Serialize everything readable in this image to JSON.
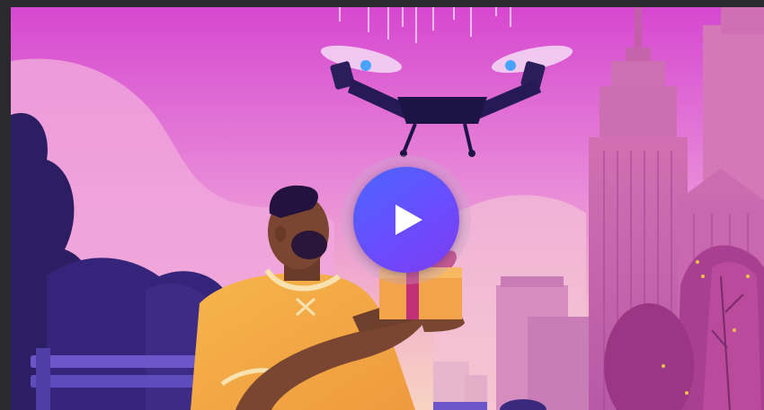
{
  "video": {
    "poster_icon": "drone-delivery-illustration",
    "play_icon": "play-icon",
    "accent_color": "#5b5cff"
  }
}
